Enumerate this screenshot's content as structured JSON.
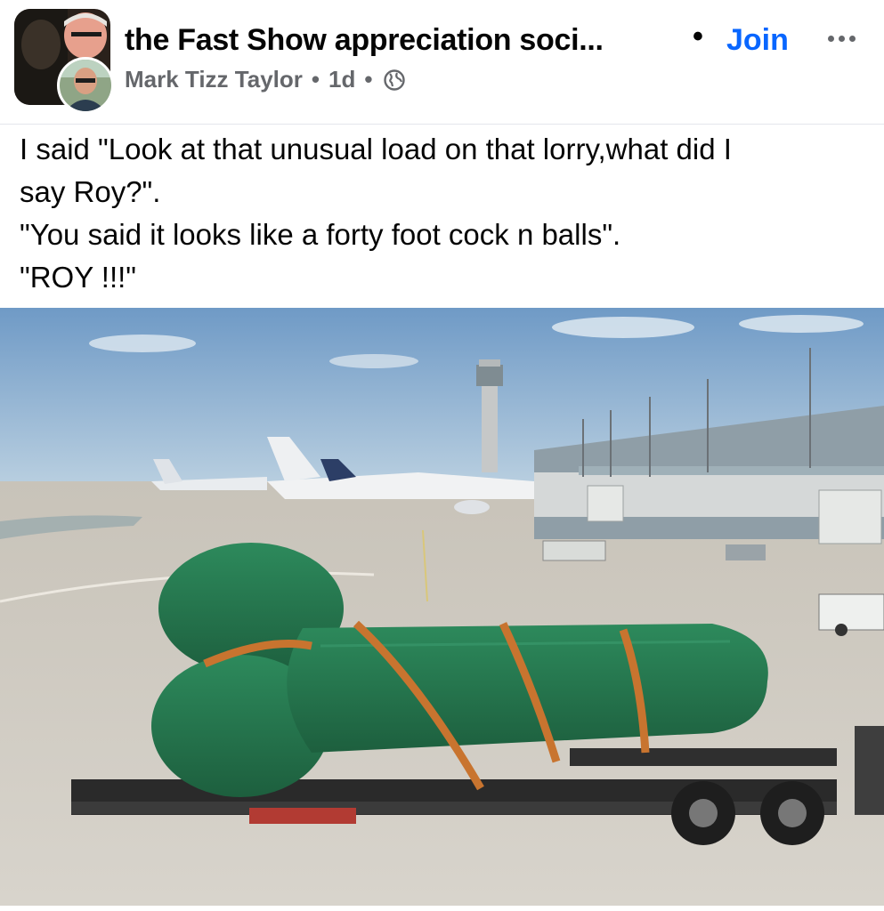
{
  "post": {
    "group_name": "the Fast Show appreciation soci...",
    "join_label": "Join",
    "author": "Mark Tizz Taylor",
    "time": "1d",
    "visibility_icon": "globe-icon",
    "text_lines": [
      "I said \"Look at that unusual load on that lorry,what did I",
      "say Roy?\".",
      "\"You said it looks like a forty foot cock n balls\".",
      "\"ROY !!!\""
    ]
  },
  "colors": {
    "join": "#0866ff",
    "meta": "#65676b",
    "text": "#050505"
  }
}
